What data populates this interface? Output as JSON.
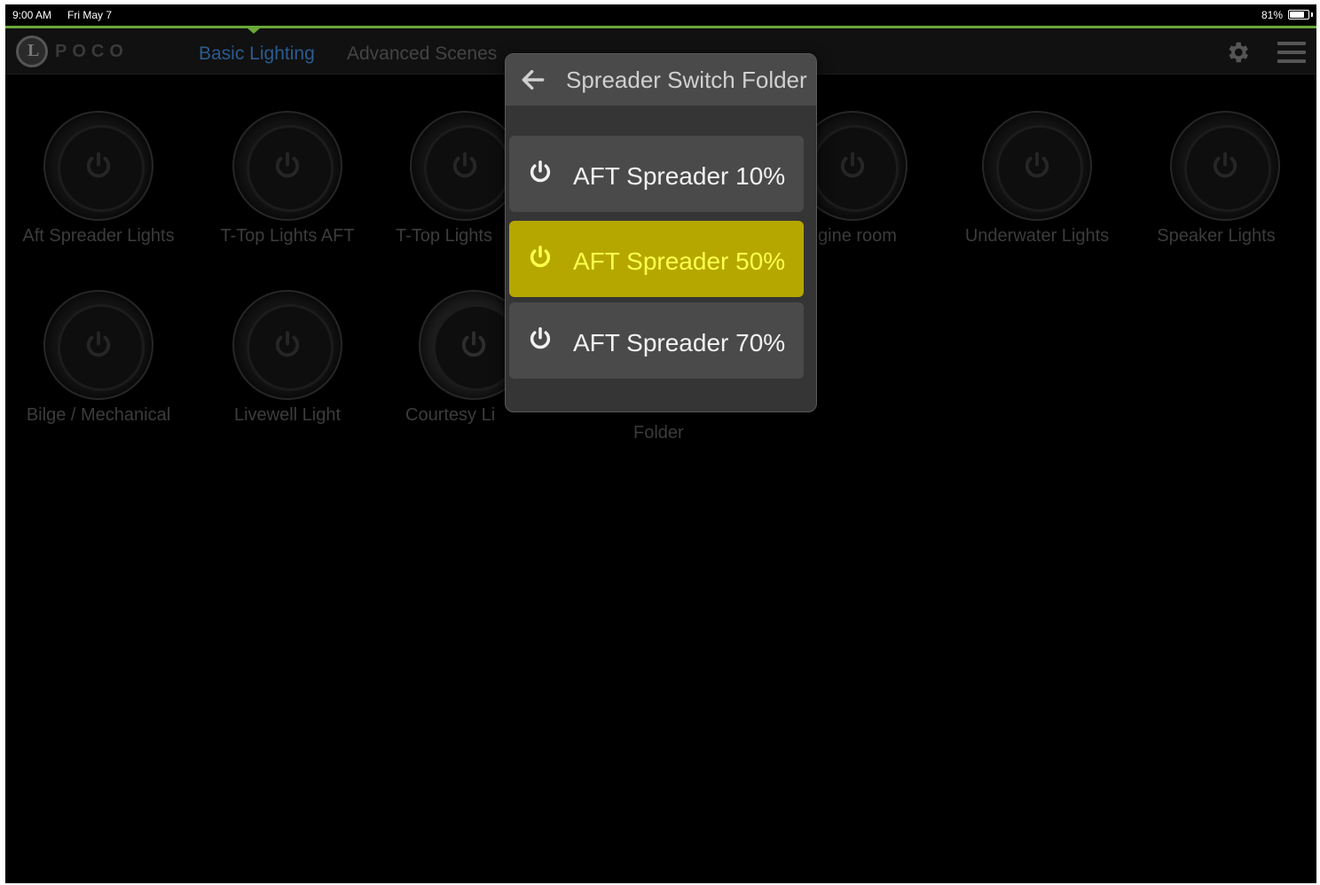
{
  "status_bar": {
    "time": "9:00 AM",
    "date": "Fri May 7",
    "battery_pct": "81%",
    "battery_level": 0.81
  },
  "nav": {
    "logo_letter": "L",
    "logo_text": "POCO",
    "tabs": [
      {
        "label": "Basic Lighting",
        "active": true
      },
      {
        "label": "Advanced Scenes",
        "active": false
      }
    ],
    "settings_icon": "gear-icon",
    "menu_icon": "hamburger-menu-icon"
  },
  "tiles": [
    {
      "label": "Aft Spreader Lights"
    },
    {
      "label": "T-Top Lights AFT"
    },
    {
      "label": "T-Top Lights"
    },
    {
      "label": "gine room"
    },
    {
      "label": "Underwater Lights"
    },
    {
      "label": "Speaker Lights"
    },
    {
      "label": "Bilge / Mechanical"
    },
    {
      "label": "Livewell Light"
    },
    {
      "label": "Courtesy Li"
    }
  ],
  "folder_label": "Folder",
  "popup": {
    "title": "Spreader Switch Folder",
    "back_icon": "back-arrow-icon",
    "options": [
      {
        "label": "AFT Spreader 10%",
        "active": false
      },
      {
        "label": "AFT Spreader 50%",
        "active": true
      },
      {
        "label": "AFT Spreader 70%",
        "active": false
      }
    ]
  },
  "colors": {
    "accent_green": "#6aa839",
    "active_tab_blue": "#2b5b8f",
    "active_option_yellow": "#b5a700",
    "active_option_text": "#ffff4a"
  }
}
